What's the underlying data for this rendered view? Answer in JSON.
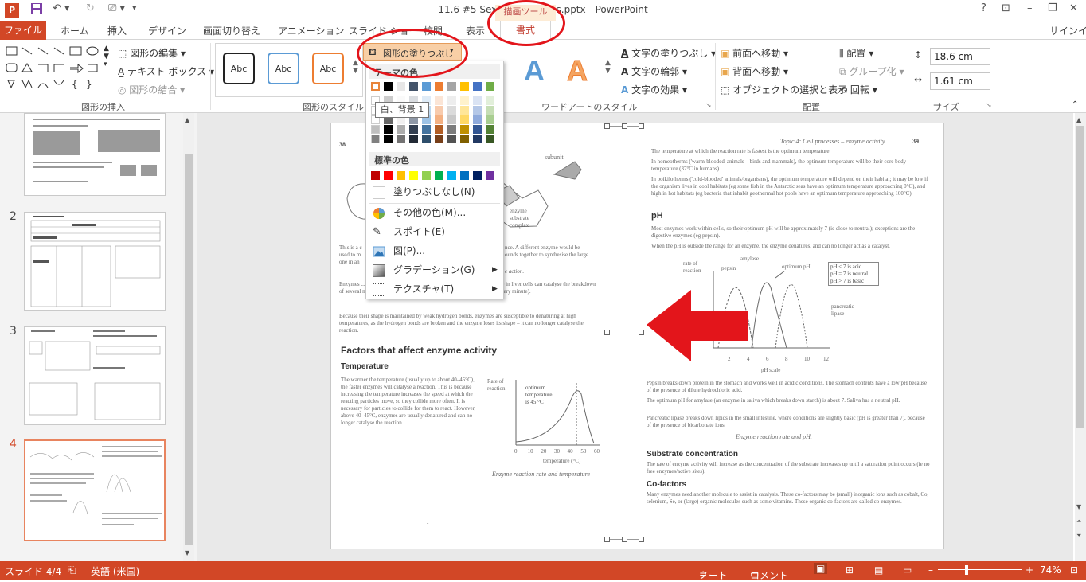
{
  "window": {
    "title": "11.6 #5 Sexual infections.pptx - PowerPoint",
    "help": "?",
    "restore_ribbon": "⊡",
    "minimize": "–",
    "maximize": "❐",
    "close": "✕"
  },
  "tabs": {
    "file": "ファイル",
    "home": "ホーム",
    "insert": "挿入",
    "design": "デザイン",
    "transitions": "画面切り替え",
    "animations": "アニメーション",
    "slideshow": "スライド ショー",
    "review": "校閲",
    "view": "表示",
    "context_group": "描画ツール",
    "format": "書式",
    "signin": "サインイン"
  },
  "ribbon": {
    "insert_shapes": {
      "label": "図形の挿入",
      "edit_shape": "図形の編集",
      "text_box": "テキスト ボックス",
      "merge_shapes": "図形の結合"
    },
    "shape_styles": {
      "label": "図形のスタイル",
      "abc": "Abc",
      "shape_fill": "図形の塗りつぶし"
    },
    "wordart_styles": {
      "label": "ワードアートのスタイル",
      "text_fill": "文字の塗りつぶし",
      "text_outline": "文字の輪郭",
      "text_effects": "文字の効果",
      "letter": "A"
    },
    "arrange": {
      "label": "配置",
      "bring_forward": "前面へ移動",
      "send_backward": "背面へ移動",
      "selection_pane": "オブジェクトの選択と表示",
      "align": "配置",
      "group": "グループ化",
      "rotate": "回転"
    },
    "size": {
      "label": "サイズ",
      "height": "18.6 cm",
      "width": "1.61 cm"
    }
  },
  "dropdown": {
    "theme_colors_title": "テーマの色",
    "standard_colors_title": "標準の色",
    "no_fill": "塗りつぶしなし(N)",
    "more_colors": "その他の色(M)...",
    "eyedropper": "スポイト(E)",
    "picture": "図(P)...",
    "gradient": "グラデーション(G)",
    "texture": "テクスチャ(T)",
    "tooltip": "白、背景 1",
    "theme_top_row": [
      "#ffffff",
      "#000000",
      "#e7e6e6",
      "#44546a",
      "#5b9bd5",
      "#ed7d31",
      "#a5a5a5",
      "#ffc000",
      "#4472c4",
      "#70ad47"
    ],
    "standard_row": [
      "#c00000",
      "#ff0000",
      "#ffc000",
      "#ffff00",
      "#92d050",
      "#00b050",
      "#00b0f0",
      "#0070c0",
      "#002060",
      "#7030a0"
    ]
  },
  "thumbnails": {
    "numbers": [
      "2",
      "3",
      "4"
    ]
  },
  "slide": {
    "page_left_num": "38",
    "page_right_num": "39",
    "page_right_header": "Topic 4: Cell processes – enzyme activity",
    "subunit_label": "subunit",
    "enzyme_substrate_label": "enzyme\nsubstrate\ncomplex",
    "left_text_1": "This is a c",
    "left_text_1b": "used to m",
    "left_text_1c": "one in an",
    "left_text_2": "nce. A different enzyme would be",
    "left_text_2b": "ounds together to synthesise the large",
    "left_text_3": "e action.",
    "enzymes_para": "Enzymes ... one enzyme molecule can catalyse the same ... (eg peroxidase in liver cells can catalyse the breakdown of several million hydrogen peroxide molecules into water and oxygen every minute).",
    "shape_para": "Because their shape is maintained by weak hydrogen bonds, enzymes are susceptible to denaturing at high temperatures, as the hydrogen bonds are broken and the enzyme loses its shape – it can no longer catalyse the reaction.",
    "factors_heading": "Factors that affect enzyme activity",
    "temperature_heading": "Temperature",
    "temperature_para": "The warmer the temperature (usually up to about 40–45°C), the faster enzymes will catalyse a reaction. This is because increasing the temperature increases the speed at which the reacting particles move, so they collide more often. It is necessary for particles to collide for them to react. However, above 40–45°C, enzymes are usually denatured and can no longer catalyse the reaction.",
    "temp_chart": {
      "ylabel": "Rate of\nreaction",
      "annotation": "optimum\ntemperature\nis 45 °C",
      "xlabel": "temperature (°C)",
      "ticks": [
        "0",
        "10",
        "20",
        "30",
        "40",
        "50",
        "60"
      ],
      "caption": "Enzyme reaction rate and temperature"
    },
    "right_para_1": "The temperature at which the reaction rate is fastest is the optimum temperature.",
    "right_para_2": "In homeotherms ('warm-blooded' animals – birds and mammals), the optimum temperature will be their core body temperature (37°C in humans).",
    "right_para_3": "In poikilotherms ('cold-blooded' animals/organisms), the optimum temperature will depend on their habitat; it may be low if the organism lives in cool habitats (eg some fish in the Antarctic seas have an optimum temperature approaching 0°C), and high in hot habitats (eg bacteria that inhabit geothermal hot pools have an optimum temperature approaching 100°C).",
    "ph_heading": "pH",
    "ph_para_1": "Most enzymes work within cells, so their optimum pH will be approximately 7 (ie close to neutral); exceptions are the digestive enzymes (eg pepsin).",
    "ph_para_2": "When the pH is outside the range for an enzyme, the enzyme denatures, and can no longer act as a catalyst.",
    "ph_chart": {
      "ylabel": "rate of\nreaction",
      "amylase": "amylase",
      "pepsin": "pepsin",
      "optimum": "optimum pH",
      "legend": [
        "pH < 7 is acid",
        "pH = 7 is neutral",
        "pH > 7 is basic"
      ],
      "pancreatic": "pancreatic\nlipase",
      "ticks": [
        "2",
        "4",
        "6",
        "8",
        "10",
        "12"
      ],
      "xlabel": "pH scale"
    },
    "pepsin_para": "Pepsin breaks down protein in the stomach and works well in acidic conditions. The stomach contents have a low pH because of the presence of dilute hydrochloric acid.",
    "amylase_para": "The optimum pH for amylase (an enzyme in saliva which breaks down starch) is about 7. Saliva has a neutral pH.",
    "lipase_para": "Pancreatic lipase breaks down lipids in the small intestine, where conditions are slightly basic (pH is greater than 7), because of the presence of bicarbonate ions.",
    "ph_caption": "Enzyme reaction rate and pH.",
    "substrate_heading": "Substrate concentration",
    "substrate_para": "The rate of enzyme activity will increase as the concentration of the substrate increases up until a saturation point occurs (ie no free enzymes/active sites).",
    "cofactors_heading": "Co-factors",
    "cofactors_para": "Many enzymes need another molecule to assist in catalysis. These co-factors may be (small) inorganic ions such as cobalt, Co, selenium, Se, or (large) organic molecules such as some vitamins. These organic co-factors are called co-enzymes."
  },
  "status": {
    "slide": "スライド 4/4",
    "language": "英語 (米国)",
    "notes": "ノート",
    "comments": "コメント",
    "zoom": "74%"
  },
  "colors": {
    "accent": "#d24726",
    "annotation_red": "#e3151b"
  }
}
